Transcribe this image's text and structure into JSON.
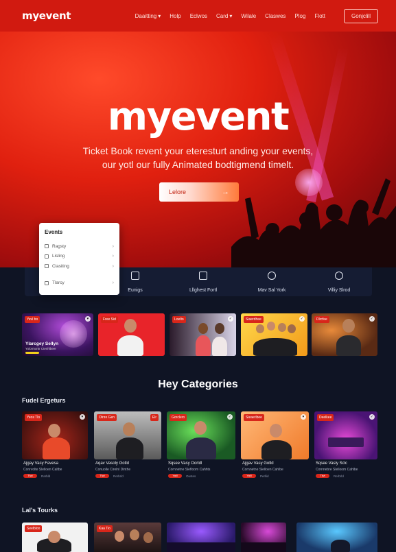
{
  "nav": {
    "logo": "myevent",
    "items": [
      {
        "label": "Daaitting",
        "has_chevron": true
      },
      {
        "label": "Holp",
        "has_chevron": false
      },
      {
        "label": "Eclwos",
        "has_chevron": false
      },
      {
        "label": "Card",
        "has_chevron": true
      },
      {
        "label": "Wilale",
        "has_chevron": false
      },
      {
        "label": "Claswes",
        "has_chevron": false
      },
      {
        "label": "Plog",
        "has_chevron": false
      },
      {
        "label": "Flott",
        "has_chevron": false
      }
    ],
    "cta": "Gonjclill"
  },
  "hero": {
    "title": "myevent",
    "subtitle_line1": "Ticket Book revent your eteresturt anding your events,",
    "subtitle_line2": "our yotl our fully Animated bodtigmend timelt.",
    "button_label": "Lelore",
    "button_arrow": "→"
  },
  "dropdown": {
    "title": "Events",
    "items": [
      {
        "label": "Ragsty",
        "icon": "calendar-icon"
      },
      {
        "label": "Lisling",
        "icon": "list-icon"
      },
      {
        "label": "Clasiting",
        "icon": "doc-icon"
      },
      {
        "label": "Tlarcy",
        "icon": "ticket-icon"
      }
    ]
  },
  "strip": {
    "items": [
      {
        "label": "Eunigs",
        "icon": "sliders-icon"
      },
      {
        "label": "Lllghest Fortl",
        "icon": "mask-icon"
      },
      {
        "label": "Mav Sal York",
        "icon": "compass-icon"
      },
      {
        "label": "Villiy Slrod",
        "icon": "clock-icon"
      }
    ]
  },
  "featured_row": [
    {
      "badge": "Yevl bo",
      "title": "Ylarcgey Sellyn",
      "subtitle": "Yolormontr Ctenhlbeer"
    },
    {
      "badge": "Free Sid"
    },
    {
      "badge": "Loelto"
    },
    {
      "badge": "Siaerdhee"
    },
    {
      "badge": "Dlrcfee"
    }
  ],
  "section_title": "Hey Categories",
  "row1_title": "Fudel Ergeturs",
  "row1": [
    {
      "badge": "Yeos Tlo",
      "title": "Ajgay Vasy Favesa",
      "subtitle": "Conrvolte Slelloen Caltbe",
      "pill": "Tlwt",
      "small": "Rarbld"
    },
    {
      "badge": "Olnre Gen",
      "title": "Aqav Vasoly Gotld",
      "subtitle": "Conuolle Cirelnl Dinthe",
      "pill": "Tlwt",
      "small": "Rerbrld"
    },
    {
      "badge": "Gorclero",
      "title": "Sqsee Vasy Oorldl",
      "subtitle": "Cornnetne Slefloom Cahhts",
      "pill": "Yaill",
      "small": "Oustes"
    },
    {
      "badge": "Sieaerlbee",
      "title": "Ajgav Vasy Gotld",
      "subtitle": "Cornnetne Slelloen Cahlbe",
      "pill": "Yaill",
      "small": "Perllid"
    },
    {
      "badge": "Deelkee",
      "title": "Sqsee Vasly Sclc",
      "subtitle": "Cornnebre Slelloom Cahlbe",
      "pill": "Tlwt",
      "small": "Rerbrld"
    }
  ],
  "row2_title": "Lal's Tourks",
  "row2": [
    {
      "badge": "Seelbloo"
    },
    {
      "badge": "Kaa Tio"
    },
    {
      "badge": ""
    },
    {
      "badge": ""
    },
    {
      "badge": ""
    }
  ],
  "colors": {
    "brand_red": "#d11a10",
    "dark_bg": "#0f1424",
    "badge_red": "#d8261a"
  }
}
